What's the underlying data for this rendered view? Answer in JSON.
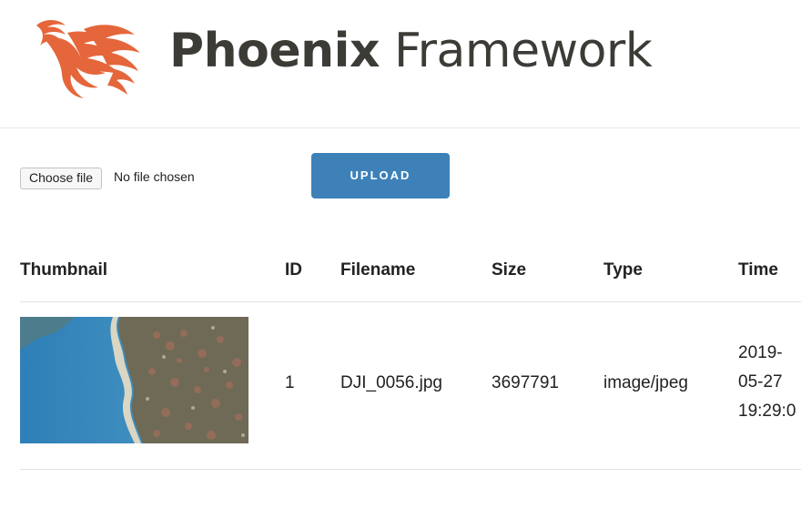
{
  "header": {
    "brand_bold": "Phoenix",
    "brand_light": " Framework",
    "logo_icon": "phoenix-bird-icon",
    "logo_color": "#e5663b"
  },
  "upload": {
    "choose_file_label": "Choose file",
    "file_status": "No file chosen",
    "upload_label": "UPLOAD",
    "upload_color": "#3d81b8"
  },
  "table": {
    "headers": {
      "thumbnail": "Thumbnail",
      "id": "ID",
      "filename": "Filename",
      "size": "Size",
      "type": "Type",
      "time": "Time"
    },
    "rows": [
      {
        "thumbnail_icon": "aerial-photo-thumbnail",
        "id": "1",
        "filename": "DJI_0056.jpg",
        "size": "3697791",
        "type": "image/jpeg",
        "time_line1": "2019-",
        "time_line2": "05-27",
        "time_line3": "19:29:0"
      }
    ]
  }
}
